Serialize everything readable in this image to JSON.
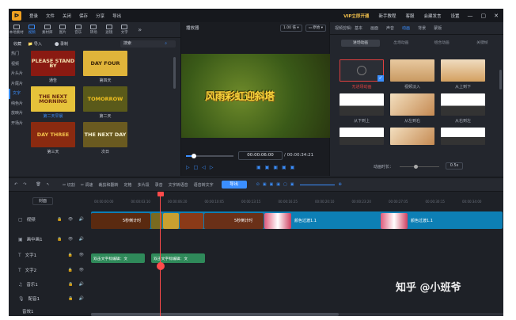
{
  "menubar": {
    "logo": "ᐅ",
    "login": "登录",
    "items": [
      "文件",
      "关闭",
      "保存",
      "分享",
      "导出"
    ],
    "vip": "VIP立即开通",
    "right_items": [
      "新手教程",
      "客服",
      "会建发言",
      "设置"
    ],
    "win": [
      "—",
      "▢",
      "✕"
    ]
  },
  "left_panel": {
    "tabs": [
      "本地素材",
      "视频",
      "素材库",
      "图片",
      "音乐",
      "转场",
      "滤镜",
      "文字",
      "»"
    ],
    "sub": {
      "collect": "收藏",
      "import": "导入",
      "record": "录制",
      "search_placeholder": "搜索"
    },
    "categories": [
      "热门",
      "视频",
      "片头片",
      "片尾片",
      "文字",
      "纯色片",
      "放映片",
      "开场片"
    ],
    "thumbs": [
      {
        "label": "通告",
        "text": "PLEASE STAND BY",
        "bg": "#8a1a12",
        "color": "#f2e0b0"
      },
      {
        "label": "第四天",
        "text": "DAY FOUR",
        "bg": "#e0b43a",
        "color": "#3a2408"
      },
      {
        "label": "第二天早晨",
        "text": "THE NEXT MORNING",
        "bg": "#e6c23a",
        "color": "#6a2a10"
      },
      {
        "label": "第二天",
        "text": "TOMORROW",
        "bg": "#5a5a1a",
        "color": "#f0c020"
      },
      {
        "label": "第三天",
        "text": "DAY THREE",
        "bg": "#8a2a10",
        "color": "#f3c14b"
      },
      {
        "label": "次日",
        "text": "THE NEXT DAY",
        "bg": "#6a5a20",
        "color": "#f5f0d0"
      }
    ]
  },
  "preview": {
    "title": "播放器",
    "zoom": "1.00 倍",
    "ratio": "原始",
    "video_text": "风雨彩虹迎斜塔",
    "time_current": "00:00:06:00",
    "time_total": "/ 00:00:34:21"
  },
  "right_panel": {
    "tabs": [
      "视频剪辑：基本",
      "画面",
      "声音",
      "动画",
      "背景",
      "蒙版"
    ],
    "subtabs": [
      "进场动画",
      "出场动画",
      "组合动画",
      "关键帧"
    ],
    "anims": [
      "无进场动画",
      "视频淡入",
      "从上到下",
      "从下到上",
      "从左到右",
      "从右到左",
      "",
      "",
      ""
    ],
    "duration_label": "动画时长：",
    "duration_value": "0.5s"
  },
  "toolbar": {
    "items": [
      "↶",
      "↷",
      "🗑",
      "↖",
      "✂ 切割",
      "✂ 调速",
      "裁剪和翻转",
      "定格",
      "多片段",
      "录音",
      "文字转语音",
      "语音转文字"
    ],
    "export": "导出"
  },
  "tracks": [
    {
      "icon": "▢",
      "name": "视频",
      "ctl": "🔒 👁 🔊"
    },
    {
      "icon": "▣",
      "name": "画中画1",
      "ctl": "🔒 👁 🔊"
    },
    {
      "icon": "T",
      "name": "文字1",
      "ctl": "🔒 👁"
    },
    {
      "icon": "T",
      "name": "文字2",
      "ctl": "🔒 👁"
    },
    {
      "icon": "♫",
      "name": "音乐1",
      "ctl": "🔒 🔊"
    },
    {
      "icon": "🎙",
      "name": "配音1",
      "ctl": "🔒 🔊"
    },
    {
      "icon": "",
      "name": "音效1",
      "ctl": ""
    }
  ],
  "clips": {
    "video1": "5秒倒计时",
    "video2": "5秒倒计时",
    "color1": "颜色过渡1.1",
    "color2": "颜色过渡1.1",
    "text1": "双击文字标编辑：文",
    "text2": "双击文字标编辑：文"
  },
  "ruler": {
    "ticks": [
      "00:00:00:00",
      "00:00:03:10",
      "00:00:06:20",
      "00:00:10:05",
      "00:00:13:15",
      "00:00:16:25",
      "00:00:20:10",
      "00:00:23:20",
      "00:00:27:05",
      "00:00:30:15",
      "00:00:34:00"
    ],
    "track_ticks": "封面"
  },
  "watermark": "知乎 @小班爷"
}
